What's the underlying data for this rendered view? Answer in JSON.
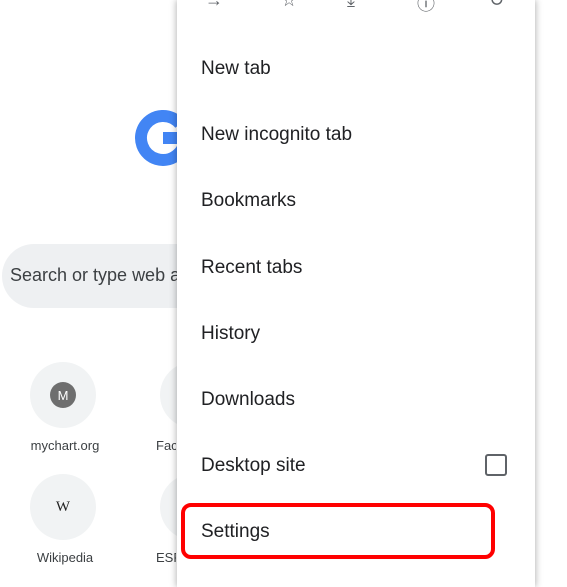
{
  "ntp": {
    "search_placeholder": "Search or type web address",
    "tiles": [
      {
        "label": "mychart.org",
        "badge": "M"
      },
      {
        "label": "Wikipedia",
        "badge": "W"
      }
    ],
    "tiles_partial": [
      {
        "label": "Facebook"
      },
      {
        "label": "ESPN"
      }
    ]
  },
  "menu": {
    "items": [
      {
        "label": "New tab"
      },
      {
        "label": "New incognito tab"
      },
      {
        "label": "Bookmarks"
      },
      {
        "label": "Recent tabs"
      },
      {
        "label": "History"
      },
      {
        "label": "Downloads"
      },
      {
        "label": "Desktop site",
        "checked": false
      },
      {
        "label": "Settings"
      }
    ]
  },
  "colors": {
    "google_blue": "#4285F4",
    "highlight": "#FF0000"
  }
}
